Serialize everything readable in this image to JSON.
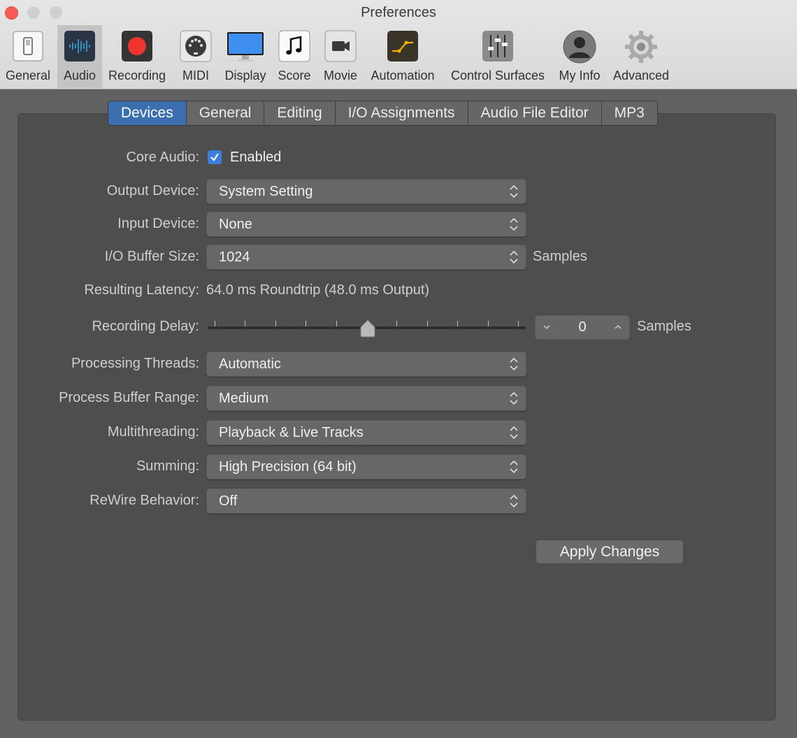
{
  "window": {
    "title": "Preferences"
  },
  "toolbar": {
    "items": [
      {
        "label": "General",
        "icon": "switch-icon"
      },
      {
        "label": "Audio",
        "icon": "waveform-icon"
      },
      {
        "label": "Recording",
        "icon": "record-icon"
      },
      {
        "label": "MIDI",
        "icon": "midi-icon"
      },
      {
        "label": "Display",
        "icon": "monitor-icon"
      },
      {
        "label": "Score",
        "icon": "music-note-icon"
      },
      {
        "label": "Movie",
        "icon": "camera-icon"
      },
      {
        "label": "Automation",
        "icon": "automation-icon"
      },
      {
        "label": "Control Surfaces",
        "icon": "faders-icon"
      },
      {
        "label": "My Info",
        "icon": "person-icon"
      },
      {
        "label": "Advanced",
        "icon": "gear-icon"
      }
    ],
    "selected": "Audio"
  },
  "tabs": {
    "items": [
      "Devices",
      "General",
      "Editing",
      "I/O Assignments",
      "Audio File Editor",
      "MP3"
    ],
    "active": "Devices"
  },
  "form": {
    "core_audio_label": "Core Audio:",
    "core_audio_checkbox": "Enabled",
    "core_audio_checked": true,
    "output_device_label": "Output Device:",
    "output_device_value": "System Setting",
    "input_device_label": "Input Device:",
    "input_device_value": "None",
    "buffer_size_label": "I/O Buffer Size:",
    "buffer_size_value": "1024",
    "buffer_size_unit": "Samples",
    "latency_label": "Resulting Latency:",
    "latency_value": "64.0 ms Roundtrip (48.0 ms Output)",
    "recording_delay_label": "Recording Delay:",
    "recording_delay_value": "0",
    "recording_delay_unit": "Samples",
    "recording_delay_slider_level": 0.5,
    "processing_threads_label": "Processing Threads:",
    "processing_threads_value": "Automatic",
    "process_buffer_label": "Process Buffer Range:",
    "process_buffer_value": "Medium",
    "multithreading_label": "Multithreading:",
    "multithreading_value": "Playback & Live Tracks",
    "summing_label": "Summing:",
    "summing_value": "High Precision (64 bit)",
    "rewire_label": "ReWire Behavior:",
    "rewire_value": "Off",
    "apply_label": "Apply Changes"
  },
  "colors": {
    "accent": "#3c6fb0",
    "checkbox": "#3d7de0",
    "close_button": "#fc5b57"
  }
}
